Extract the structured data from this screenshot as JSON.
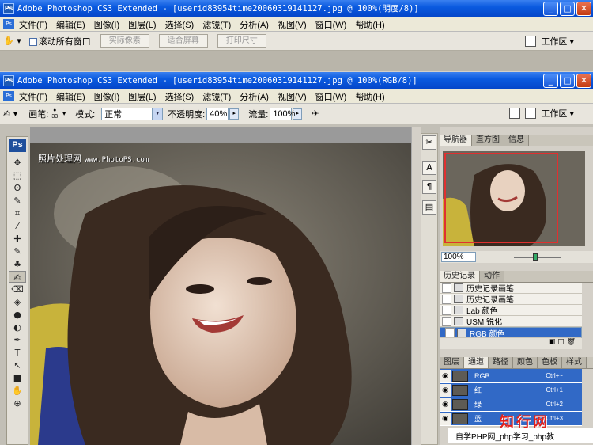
{
  "back_window": {
    "title": "Adobe Photoshop CS3 Extended - [userid83954time20060319141127.jpg @ 100%(明度/8)]",
    "menu": [
      "文件(F)",
      "编辑(E)",
      "图像(I)",
      "图层(L)",
      "选择(S)",
      "滤镜(T)",
      "分析(A)",
      "视图(V)",
      "窗口(W)",
      "帮助(H)"
    ],
    "options": {
      "scroll_all_label": "滚动所有窗口",
      "actual_pixels": "实际像素",
      "fit_screen": "适合屏幕",
      "print_size": "打印尺寸"
    },
    "workspace_label": "工作区 ▾"
  },
  "front_window": {
    "title": "Adobe Photoshop CS3 Extended - [userid83954time20060319141127.jpg @ 100%(RGB/8)]",
    "menu": [
      "文件(F)",
      "编辑(E)",
      "图像(I)",
      "图层(L)",
      "选择(S)",
      "滤镜(T)",
      "分析(A)",
      "视图(V)",
      "窗口(W)",
      "帮助(H)"
    ],
    "options": {
      "brush_label": "画笔:",
      "brush_size": "33",
      "mode_label": "模式:",
      "mode_value": "正常",
      "opacity_label": "不透明度:",
      "opacity_value": "40%",
      "flow_label": "流量:",
      "flow_value": "100%"
    },
    "workspace_label": "工作区 ▾"
  },
  "toolbox": {
    "logo": "Ps",
    "tools": [
      "✥",
      "⬚",
      "ʘ",
      "✎",
      "⌗",
      "⁄",
      "✚",
      "✎",
      "♣",
      "✍",
      "⌫",
      "◈",
      "●",
      "◐",
      "✒",
      "T",
      "↖",
      "■",
      "✋",
      "⊕"
    ]
  },
  "canvas": {
    "watermark": "照片处理网",
    "watermark_url": "www.PhotoPS.com"
  },
  "navigator": {
    "tabs": [
      "导航器",
      "直方图",
      "信息"
    ],
    "zoom": "100%"
  },
  "history": {
    "tabs": [
      "历史记录",
      "动作"
    ],
    "items": [
      {
        "label": "历史记录画笔",
        "selected": false
      },
      {
        "label": "历史记录画笔",
        "selected": false
      },
      {
        "label": "Lab 颜色",
        "selected": false
      },
      {
        "label": "USM 锐化",
        "selected": false
      },
      {
        "label": "RGB 颜色",
        "selected": true
      }
    ]
  },
  "layers": {
    "tabs": [
      "图层",
      "通道",
      "路径",
      "颜色",
      "色板",
      "样式"
    ],
    "channels": [
      {
        "label": "RGB",
        "shortcut": "Ctrl+~"
      },
      {
        "label": "红",
        "shortcut": "Ctrl+1"
      },
      {
        "label": "绿",
        "shortcut": "Ctrl+2"
      },
      {
        "label": "蓝",
        "shortcut": "Ctrl+3"
      }
    ]
  },
  "branding": {
    "logo_text": "知行网",
    "footer_text": "自学PHP网_php学习_php教"
  }
}
